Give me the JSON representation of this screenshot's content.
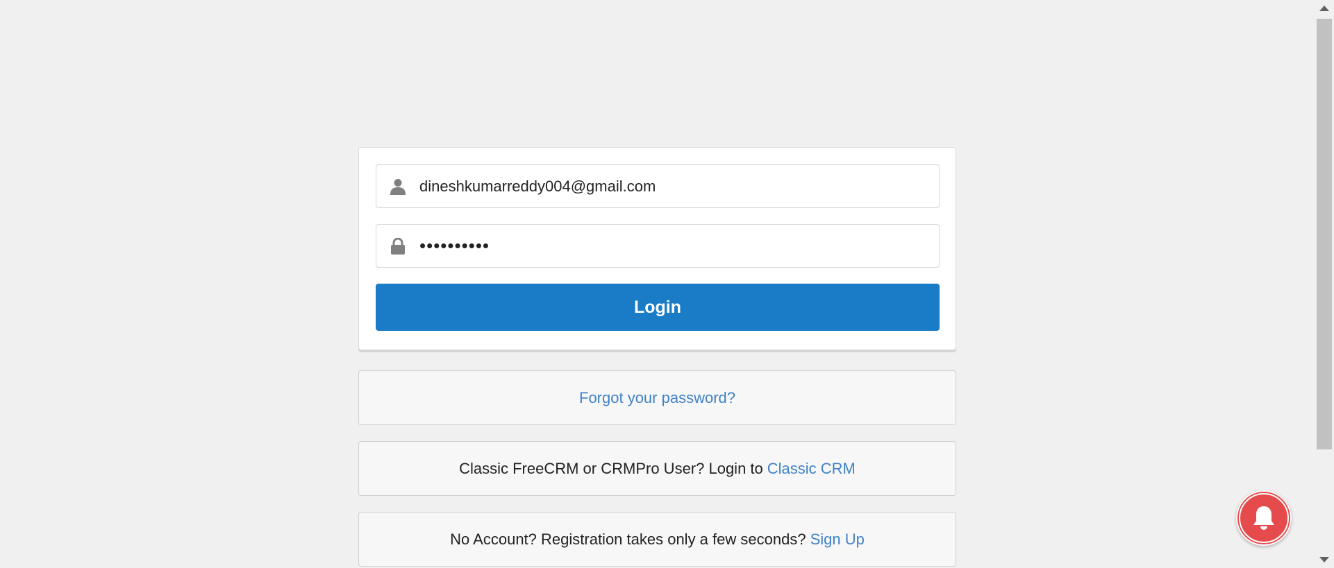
{
  "login_form": {
    "email_value": "dineshkumarreddy004@gmail.com",
    "password_mask": "••••••••••",
    "email_icon": "user-icon",
    "password_icon": "lock-icon",
    "login_label": "Login"
  },
  "forgot": {
    "link_text": "Forgot your password?"
  },
  "classic": {
    "text": "Classic FreeCRM or CRMPro User? Login to",
    "link_text": "Classic CRM"
  },
  "signup": {
    "text": "No Account? Registration takes only a few seconds?",
    "link_text": "Sign Up"
  },
  "notification": {
    "icon": "bell-icon"
  },
  "colors": {
    "primary": "#1a7cc6",
    "link": "#3f82c6",
    "notification": "#e54b4d",
    "background": "#f0f0f0"
  }
}
